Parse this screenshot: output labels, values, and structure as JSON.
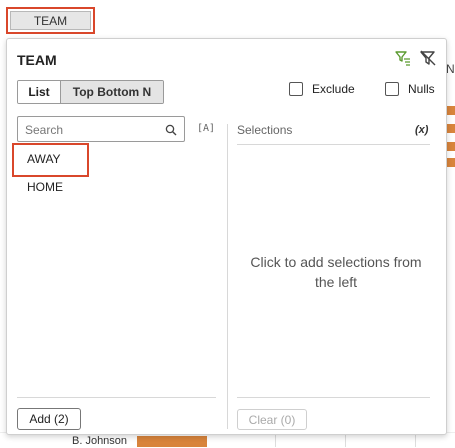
{
  "toolbar": {
    "team_chip_label": "TEAM"
  },
  "background": {
    "right_edge_letter": "N",
    "bottom_player_label": "B. Johnson",
    "bar_color": "#d8843c"
  },
  "popup": {
    "title": "TEAM",
    "icons": {
      "apply_filter": "funnel-sort-icon",
      "clear_filter": "filter-remove-icon"
    },
    "mode_tabs": [
      {
        "label": "List",
        "selected": true
      },
      {
        "label": "Top Bottom N",
        "selected": false
      }
    ],
    "options": [
      {
        "label": "Exclude",
        "checked": false
      },
      {
        "label": "Nulls",
        "checked": false
      }
    ],
    "search": {
      "placeholder": "Search",
      "case_toggle_label": "[A]"
    },
    "values": [
      {
        "label": "AWAY",
        "highlighted": true
      },
      {
        "label": "HOME",
        "highlighted": false
      }
    ],
    "selections": {
      "header": "Selections",
      "variable_toggle": "(x)",
      "empty_message": "Click to add selections from the left"
    },
    "add_button_label": "Add (2)",
    "clear_button_label": "Clear (0)"
  },
  "colors": {
    "highlight": "#d9472b",
    "filter_icon_green": "#5a9a2e"
  }
}
